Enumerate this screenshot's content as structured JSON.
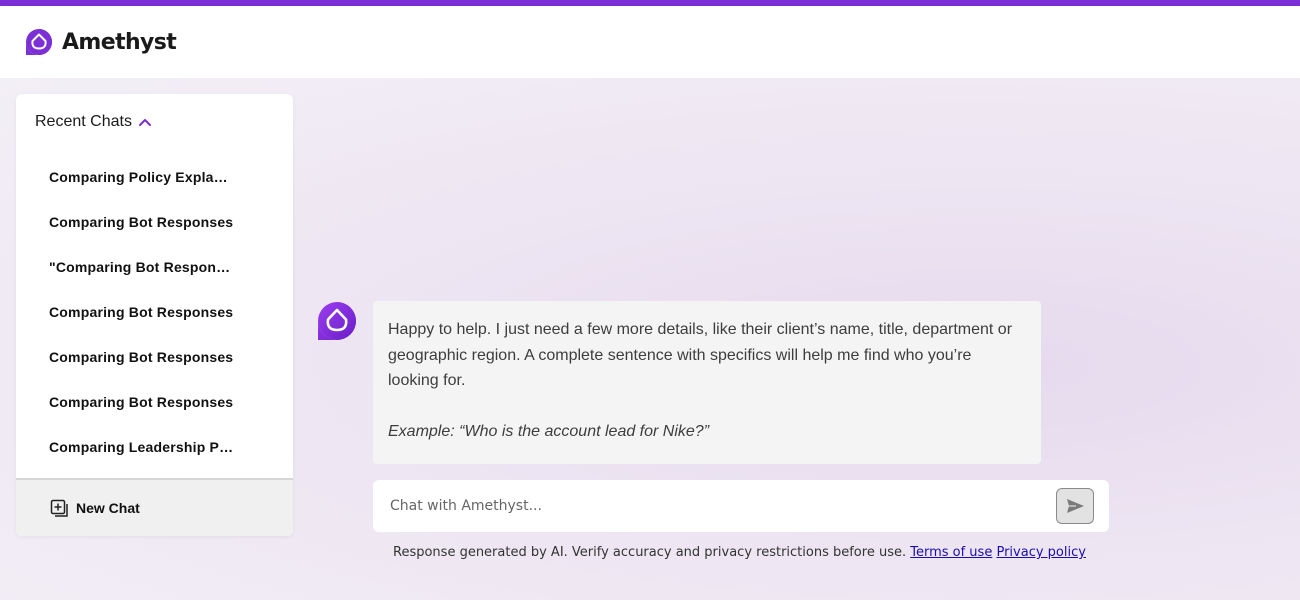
{
  "app": {
    "name": "Amethyst",
    "accent_color": "#7b2fd4",
    "logo_icon": "amethyst-logo-icon"
  },
  "sidebar": {
    "title": "Recent Chats",
    "toggle_icon": "chevron-up-icon",
    "items": [
      {
        "label": "Comparing Policy Explanations"
      },
      {
        "label": "Comparing Bot Responses"
      },
      {
        "label": "\"Comparing Bot Responses\""
      },
      {
        "label": "Comparing Bot Responses"
      },
      {
        "label": "Comparing Bot Responses"
      },
      {
        "label": "Comparing Bot Responses"
      },
      {
        "label": "Comparing Leadership Profiles"
      }
    ],
    "new_chat_label": "New Chat",
    "new_chat_icon": "plus-square-icon"
  },
  "conversation": {
    "bot_message": {
      "text": "Happy to help. I just need a few more details, like their client’s name, title, department or geographic region. A complete sentence with specifics will help me find who you’re looking for.",
      "example": "Example: “Who is the account lead for Nike?”"
    }
  },
  "composer": {
    "placeholder": "Chat with Amethyst...",
    "value": "",
    "send_icon": "send-icon"
  },
  "footer": {
    "disclaimer": "Response generated by AI. Verify accuracy and privacy restrictions before use.",
    "terms_label": "Terms of use",
    "privacy_label": "Privacy policy"
  }
}
